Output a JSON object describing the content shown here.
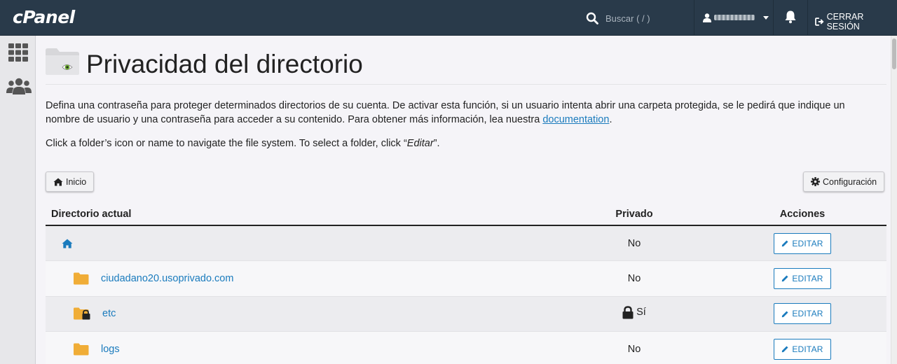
{
  "header": {
    "logo": "cPanel",
    "search_placeholder": "Buscar ( / )",
    "logout_label": "CERRAR SESIÓN"
  },
  "page": {
    "title": "Privacidad del directorio",
    "description": "Defina una contraseña para proteger determinados directorios de su cuenta. De activar esta función, si un usuario intenta abrir una carpeta protegida, se le pedirá que indique un nombre de usuario y una contraseña para acceder a su contenido. Para obtener más información, lea nuestra ",
    "doc_link": "documentation",
    "desc_end": ".",
    "hint_start": "Click a folder’s icon or name to navigate the file system. To select a folder, click “",
    "hint_em": "Editar",
    "hint_end": "”."
  },
  "buttons": {
    "home": "Inicio",
    "config": "Configuración"
  },
  "table": {
    "headers": [
      "Directorio actual",
      "Privado",
      "Acciones"
    ],
    "rows": [
      {
        "name": "",
        "private": "No",
        "action": "EDITAR",
        "icon": "home-icon"
      },
      {
        "name": "ciudadano20.usoprivado.com",
        "private": "No",
        "action": "EDITAR",
        "icon": "folder-icon"
      },
      {
        "name": "etc",
        "private": "Sí",
        "action": "EDITAR",
        "icon": "locked-folder-icon"
      },
      {
        "name": "logs",
        "private": "No",
        "action": "EDITAR",
        "icon": "folder-icon"
      }
    ]
  },
  "colors": {
    "topbar": "#293a4a",
    "link": "#1a7bbd",
    "folder": "#f0ad37"
  }
}
